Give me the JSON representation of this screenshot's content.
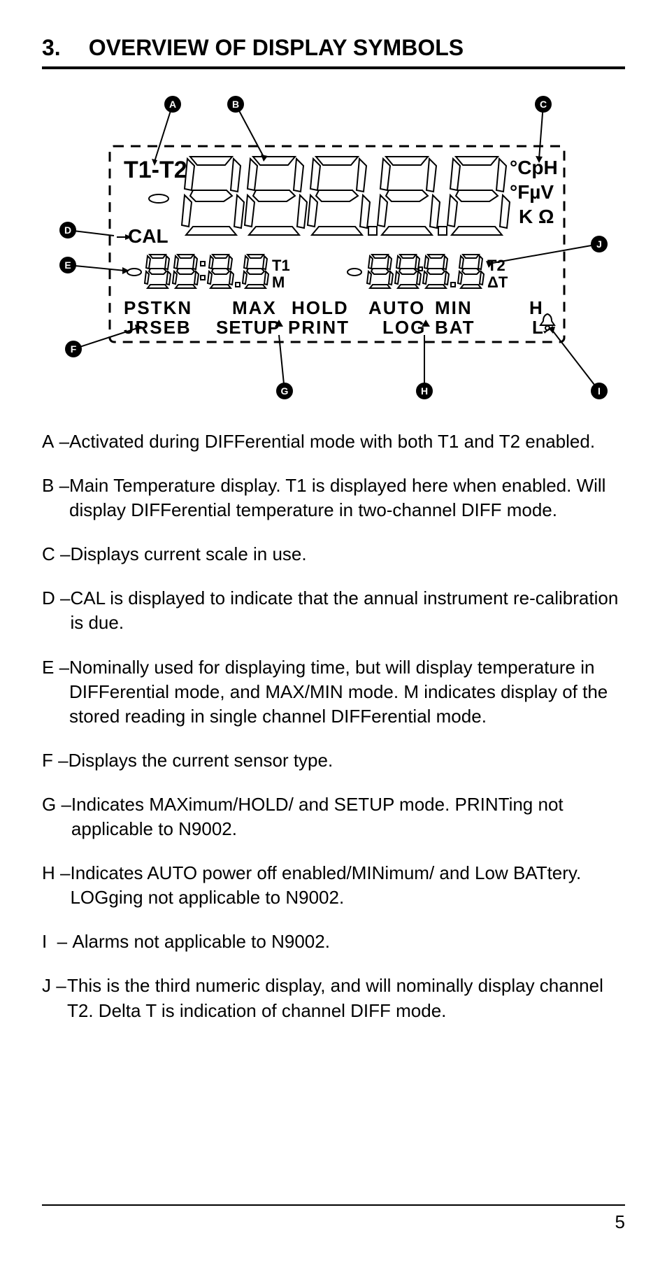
{
  "page_number": "5",
  "heading": {
    "number": "3.",
    "title": "OVERVIEW OF DISPLAY SYMBOLS"
  },
  "diagram": {
    "labels": {
      "t1t2": "T1-T2",
      "chp": "°CpH",
      "fuv": "°FµV",
      "kohm": "K Ω",
      "cal": "CAL",
      "t1": "T1",
      "m": "M",
      "t2": "T2",
      "dt": "ΔT",
      "pstkn": "PSTKN",
      "jrseb": "JRSEB",
      "max": "MAX",
      "setup": "SETUP",
      "hold": "HOLD",
      "print": "PRINT",
      "auto": "AUTO",
      "log": "LOG",
      "min": "MIN",
      "bat": "BAT",
      "h": "H",
      "l": "L"
    },
    "callouts": [
      "A",
      "B",
      "C",
      "D",
      "E",
      "F",
      "G",
      "H",
      "I",
      "J"
    ]
  },
  "legend": {
    "A": "Activated during DIFFerential mode with both T1 and T2 enabled.",
    "B": "Main Temperature display. T1 is displayed here when enabled. Will display DIFFerential temperature in two-channel DIFF mode.",
    "C": "Displays current scale in use.",
    "D": "CAL is displayed to indicate that the annual instrument re-calibration is due.",
    "E": "Nominally used for displaying time, but will display temperature in DIFFerential mode, and MAX/MIN mode. M indicates display of the stored reading in single channel DIFFerential mode.",
    "F": "Displays the current sensor type.",
    "G": "Indicates MAXimum/HOLD/ and SETUP mode. PRINTing not applicable to N9002.",
    "H": "Indicates AUTO power off enabled/MINimum/ and Low BATtery. LOGging not applicable to N9002.",
    "I": "Alarms not applicable to N9002.",
    "J": "This is the third numeric display, and will nominally display channel T2. Delta T is indication of channel DIFF mode."
  }
}
